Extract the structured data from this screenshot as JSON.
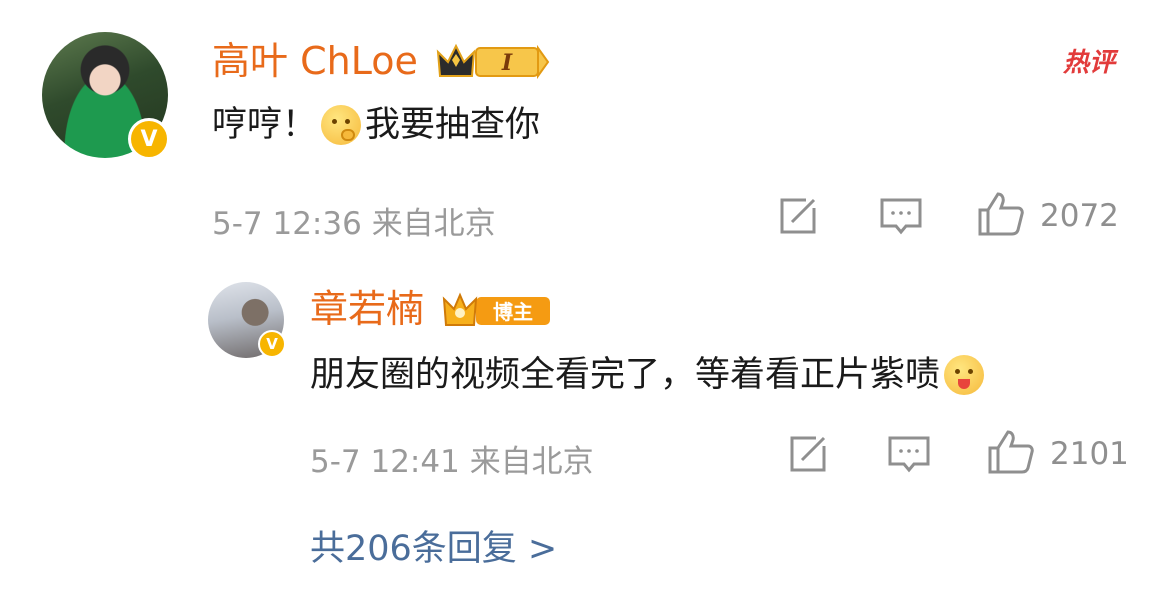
{
  "comment": {
    "user_name": "高叶 ChLoe",
    "level_badge": "I",
    "hot_tag": "热评",
    "text_before_emoji": "哼哼！",
    "text_after_emoji": "我要抽查你",
    "emoji": "thinking-face-emoji",
    "time": "5-7 12:36",
    "location": "来自北京",
    "like_count": "2072"
  },
  "reply": {
    "user_name": "章若楠",
    "role_badge": "博主",
    "text_before_emoji": "朋友圈的视频全看完了，等着看正片紫啧",
    "emoji": "tongue-face-emoji",
    "time": "5-7 12:41",
    "location": "来自北京",
    "like_count": "2101"
  },
  "more_replies": "共206条回复 >",
  "colors": {
    "name": "#e86a1a",
    "meta": "#9a9a9a",
    "link": "#4a6d9a",
    "verified": "#f7b500",
    "hot": "#e23b3b"
  }
}
